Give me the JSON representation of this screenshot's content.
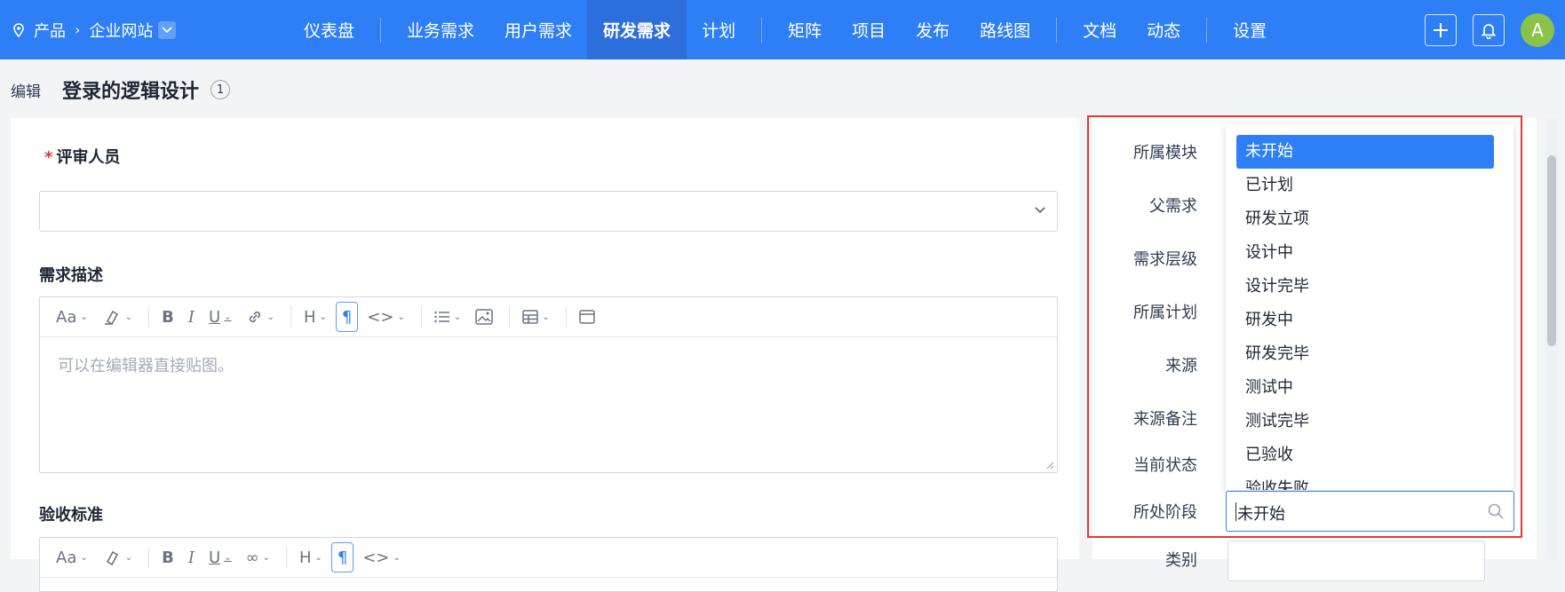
{
  "topbar": {
    "product_label": "产品",
    "project_label": "企业网站",
    "nav": [
      "仪表盘",
      "业务需求",
      "用户需求",
      "研发需求",
      "计划",
      "矩阵",
      "项目",
      "发布",
      "路线图",
      "文档",
      "动态",
      "设置"
    ],
    "active_nav": "研发需求",
    "avatar_letter": "A"
  },
  "page": {
    "edit_label": "编辑",
    "title": "登录的逻辑设计",
    "badge": "1"
  },
  "form": {
    "reviewer_label": "评审人员",
    "required_mark": "*",
    "desc_label": "需求描述",
    "editor_placeholder": "可以在编辑器直接贴图。",
    "accept_label": "验收标准"
  },
  "sidebar": {
    "fields": [
      "所属模块",
      "父需求",
      "需求层级",
      "所属计划",
      "来源",
      "来源备注",
      "当前状态",
      "所处阶段"
    ],
    "next_field_partial": "类别"
  },
  "dropdown": {
    "options": [
      "未开始",
      "已计划",
      "研发立项",
      "设计中",
      "设计完毕",
      "研发中",
      "研发完毕",
      "测试中",
      "测试完毕",
      "已验收",
      "验收失败"
    ],
    "selected": "未开始",
    "search_value": "未开始"
  },
  "colors": {
    "brand": "#2e7ff5",
    "highlight": "#e53935"
  }
}
